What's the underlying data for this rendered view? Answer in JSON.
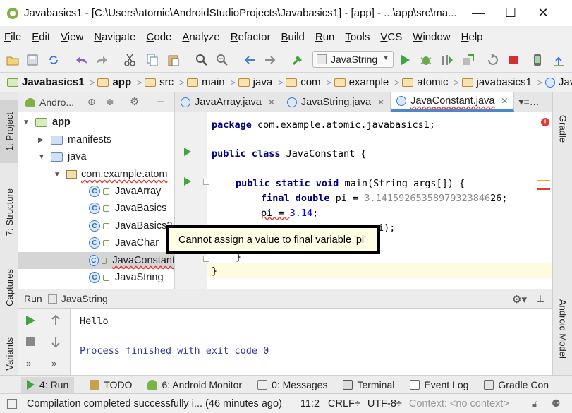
{
  "window": {
    "title": "Javabasics1 - [C:\\Users\\atomic\\AndroidStudioProjects\\Javabasics1] - [app] - ...\\app\\src\\ma...",
    "minimize": "—",
    "maximize": "☐",
    "close": "✕"
  },
  "menu": [
    "File",
    "Edit",
    "View",
    "Navigate",
    "Code",
    "Analyze",
    "Refactor",
    "Build",
    "Run",
    "Tools",
    "VCS",
    "Window",
    "Help"
  ],
  "toolbar": {
    "run_config": "JavaString",
    "colors": {
      "run": "#3fa63f",
      "stop": "#d32f2f",
      "build": "#3fa63f"
    }
  },
  "breadcrumb": [
    "Javabasics1",
    "app",
    "src",
    "main",
    "java",
    "com",
    "example",
    "atomic",
    "javabasics1",
    "JavaC"
  ],
  "left_tabs": [
    "1: Project",
    "7: Structure",
    "Captures",
    "Variants"
  ],
  "right_tabs": [
    "Gradle",
    "Android Model"
  ],
  "project": {
    "view_label": "Andro...",
    "tree": [
      {
        "label": "app",
        "kind": "app"
      },
      {
        "label": "manifests",
        "kind": "folder"
      },
      {
        "label": "java",
        "kind": "folder"
      },
      {
        "label": "com.example.atom",
        "kind": "package"
      },
      {
        "label": "JavaArray",
        "kind": "class"
      },
      {
        "label": "JavaBasics",
        "kind": "class"
      },
      {
        "label": "JavaBasics2",
        "kind": "class"
      },
      {
        "label": "JavaChar",
        "kind": "class"
      },
      {
        "label": "JavaConstant",
        "kind": "class"
      },
      {
        "label": "JavaString",
        "kind": "class"
      }
    ]
  },
  "editor_tabs": [
    {
      "label": "JavaArray.java",
      "close": "✕"
    },
    {
      "label": "JavaString.java",
      "close": "✕"
    },
    {
      "label": "JavaConstant.java",
      "close": "✕"
    },
    {
      "label": "≡",
      "close": ""
    }
  ],
  "editor_tabs_overflow": "▾≡…",
  "code": {
    "line1": {
      "kw": "package",
      "rest": " com.example.atomic.javabasics1;"
    },
    "line2": {
      "kw": "public class",
      "rest": " JavaConstant {"
    },
    "line3": {
      "kw": "public static void",
      "rest": " main(String args[]) {"
    },
    "line4": {
      "kw": "final double",
      "rest": " pi = ",
      "num": "3.14159265358979323846",
      "end": "26;"
    },
    "line5": {
      "pre": "pi = ",
      "num": "3.14",
      "end": ";"
    },
    "line6": {
      "text": "i);"
    },
    "line7": {
      "text": "}"
    },
    "line8": {
      "text": "}"
    }
  },
  "tooltip": "Cannot assign a value to final variable 'pi'",
  "run_panel": {
    "title": "Run",
    "config": "JavaString",
    "output": [
      "Hello",
      "",
      "Process finished with exit code 0"
    ]
  },
  "bottom_tabs": [
    {
      "label": "4: Run"
    },
    {
      "label": "TODO"
    },
    {
      "label": "6: Android Monitor"
    },
    {
      "label": "0: Messages"
    },
    {
      "label": "Terminal"
    },
    {
      "label": "Event Log"
    },
    {
      "label": "Gradle Con"
    }
  ],
  "status": {
    "message": "Compilation completed successfully i... (46 minutes ago)",
    "position": "11:2",
    "line_sep": "CRLF÷",
    "encoding": "UTF-8÷",
    "context": "Context: <no context>"
  }
}
